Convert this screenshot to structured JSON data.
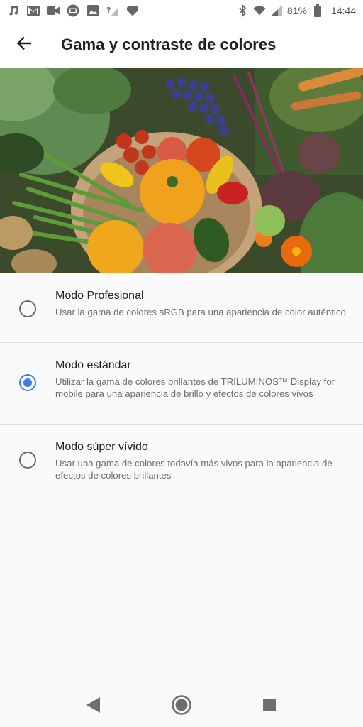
{
  "status_bar": {
    "battery": "81%",
    "time": "14:44",
    "left_icons": [
      "music-note-icon",
      "gmail-icon",
      "video-camera-icon",
      "tv-icon",
      "image-icon",
      "no-signal-icon",
      "heart-icon"
    ],
    "right_icons": [
      "bluetooth-icon",
      "wifi-icon",
      "cell-signal-icon",
      "battery-icon"
    ]
  },
  "app_bar": {
    "title": "Gama y contraste de colores",
    "back_icon": "arrow-back-icon"
  },
  "options": [
    {
      "title": "Modo Profesional",
      "description": "Usar la gama de colores sRGB para una apariencia de color auténtico",
      "selected": false
    },
    {
      "title": "Modo estándar",
      "description": "Utilizar la gama de colores brillantes de TRILUMINOS™ Display for mobile para una apariencia de brillo y efectos de colores vivos",
      "selected": true
    },
    {
      "title": "Modo súper vívido",
      "description": "Usar una gama de colores todavía más vivos para la apariencia de efectos de colores brillantes",
      "selected": false
    }
  ],
  "nav_bar": {
    "icons": [
      "nav-back-icon",
      "nav-home-icon",
      "nav-recents-icon"
    ]
  },
  "colors": {
    "accent": "#3f7ee0",
    "background": "#fafafa"
  }
}
